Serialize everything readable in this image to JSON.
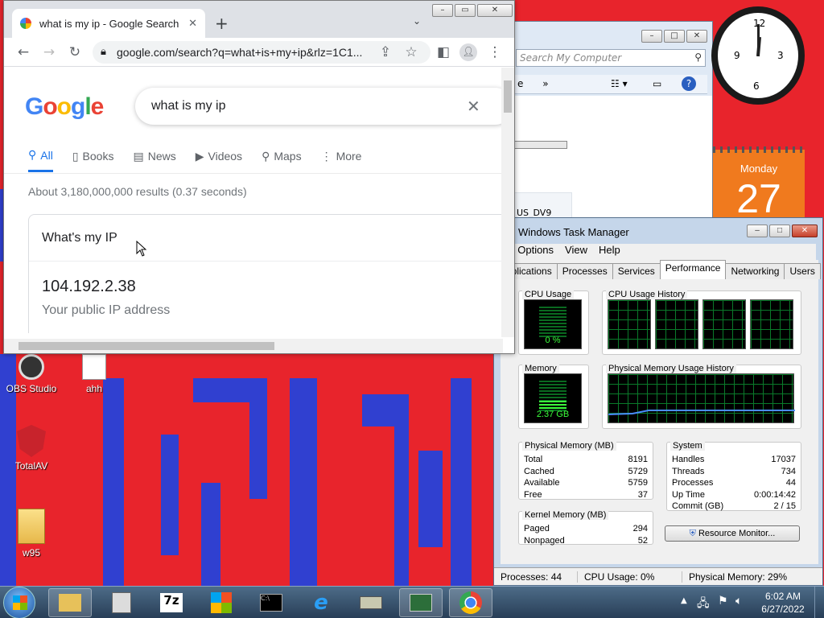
{
  "chrome": {
    "tab_title": "what is my ip - Google Search",
    "url": "google.com/search?q=what+is+my+ip&rlz=1C1...",
    "logo": "Google",
    "query": "what is my ip",
    "tabs": [
      "All",
      "Books",
      "News",
      "Videos",
      "Maps",
      "More"
    ],
    "result_stats": "About 3,180,000,000 results (0.37 seconds)",
    "card_heading": "What's my IP",
    "ip_address": "104.192.2.38",
    "ip_caption": "Your public IP address"
  },
  "explorer": {
    "search_placeholder": "Search My Computer",
    "nav_fragment": "e",
    "drive_label": "US_DV9"
  },
  "calendar": {
    "weekday": "Monday",
    "day": "27"
  },
  "desktop_icons": [
    "OBS Studio",
    "ahh",
    "TotalAV",
    "w95"
  ],
  "taskman": {
    "title": "Windows Task Manager",
    "menu": [
      "e",
      "Options",
      "View",
      "Help"
    ],
    "tabs": [
      "pplications",
      "Processes",
      "Services",
      "Performance",
      "Networking",
      "Users"
    ],
    "cpu_label": "CPU Usage",
    "cpu_value": "0 %",
    "cpu_fraction": 0.0,
    "cpu_history_label": "CPU Usage History",
    "memory_label": "Memory",
    "memory_value": "2.37 GB",
    "memory_fraction": 0.29,
    "mem_history_label": "Physical Memory Usage History",
    "physical_memory": {
      "title": "Physical Memory (MB)",
      "rows": [
        [
          "Total",
          "8191"
        ],
        [
          "Cached",
          "5729"
        ],
        [
          "Available",
          "5759"
        ],
        [
          "Free",
          "37"
        ]
      ]
    },
    "kernel_memory": {
      "title": "Kernel Memory (MB)",
      "rows": [
        [
          "Paged",
          "294"
        ],
        [
          "Nonpaged",
          "52"
        ]
      ]
    },
    "system": {
      "title": "System",
      "rows": [
        [
          "Handles",
          "17037"
        ],
        [
          "Threads",
          "734"
        ],
        [
          "Processes",
          "44"
        ],
        [
          "Up Time",
          "0:00:14:42"
        ],
        [
          "Commit (GB)",
          "2 / 15"
        ]
      ]
    },
    "resource_button": "Resource Monitor...",
    "status": {
      "processes": "Processes: 44",
      "cpu": "CPU Usage: 0%",
      "memory": "Physical Memory: 29%"
    }
  },
  "taskbar": {
    "time": "6:02 AM",
    "date": "6/27/2022"
  }
}
